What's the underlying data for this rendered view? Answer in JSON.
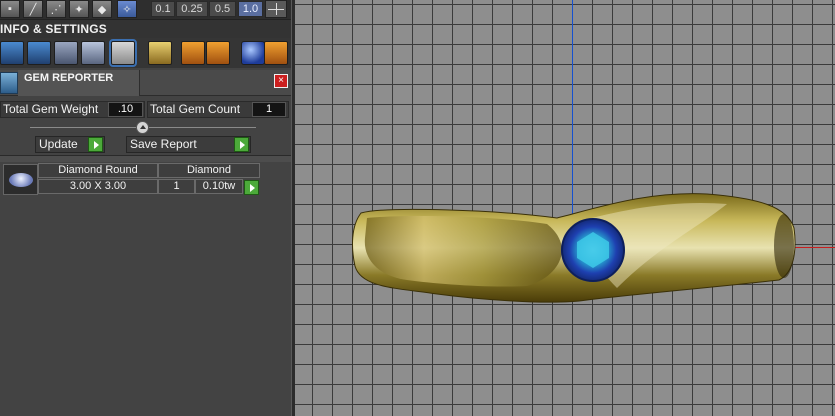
{
  "toolbar": {
    "snap_values": [
      "0.1",
      "0.25",
      "0.5",
      "1.0"
    ],
    "active_snap": "1.0",
    "icons": [
      "cube-icon",
      "wand-icon",
      "line-tool-icon",
      "eye-icon",
      "pointer-icon"
    ]
  },
  "info_settings": {
    "title": "INFO & SETTINGS"
  },
  "gem_reporter": {
    "title": "GEM REPORTER",
    "close_icon": "×",
    "total_gem_weight_label": "Total Gem Weight",
    "total_gem_weight_value": ".10",
    "total_gem_count_label": "Total Gem Count",
    "total_gem_count_value": "1",
    "update_label": "Update",
    "save_report_label": "Save Report",
    "gems": [
      {
        "shape": "Diamond Round",
        "type": "Diamond",
        "size": "3.00 X 3.00",
        "count": "1",
        "weight": "0.10tw"
      }
    ]
  },
  "colors": {
    "panel_bg": "#434343",
    "grid_bg": "#8e8e8e",
    "axis_blue": "#1450d0",
    "axis_red": "#c81e1e",
    "accent_green": "#4caa3a",
    "close_red": "#cc2020",
    "gem_blue": "#1e40b0",
    "metal_gold": "#b8a23c"
  }
}
